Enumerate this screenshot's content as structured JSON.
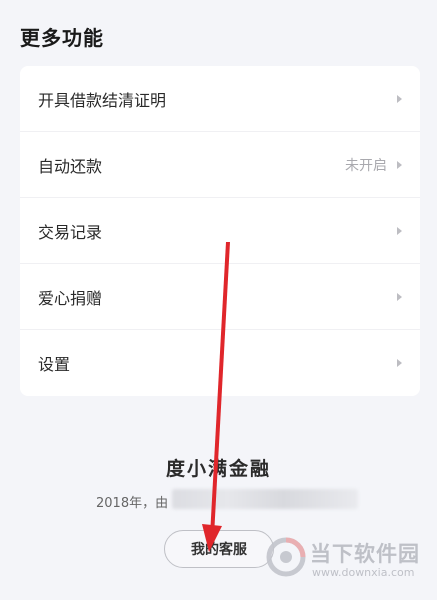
{
  "section": {
    "title": "更多功能"
  },
  "menu": {
    "items": [
      {
        "label": "开具借款结清证明",
        "status": ""
      },
      {
        "label": "自动还款",
        "status": "未开启"
      },
      {
        "label": "交易记录",
        "status": ""
      },
      {
        "label": "爱心捐赠",
        "status": ""
      },
      {
        "label": "设置",
        "status": ""
      }
    ]
  },
  "footer": {
    "brand": "度小满金融",
    "notice_prefix": "2018年，由",
    "service_button": "我的客服"
  },
  "watermark": {
    "name": "当下软件园",
    "url": "www.downxia.com"
  },
  "colors": {
    "background": "#f4f5f9",
    "card": "#ffffff",
    "annotation_arrow": "#e0262b",
    "muted_text": "#a9a9ae"
  },
  "icons": {
    "row_chevron": "chevron-right-icon",
    "annotation": "red-arrow-annotation",
    "watermark_logo": "downxia-logo-icon"
  }
}
